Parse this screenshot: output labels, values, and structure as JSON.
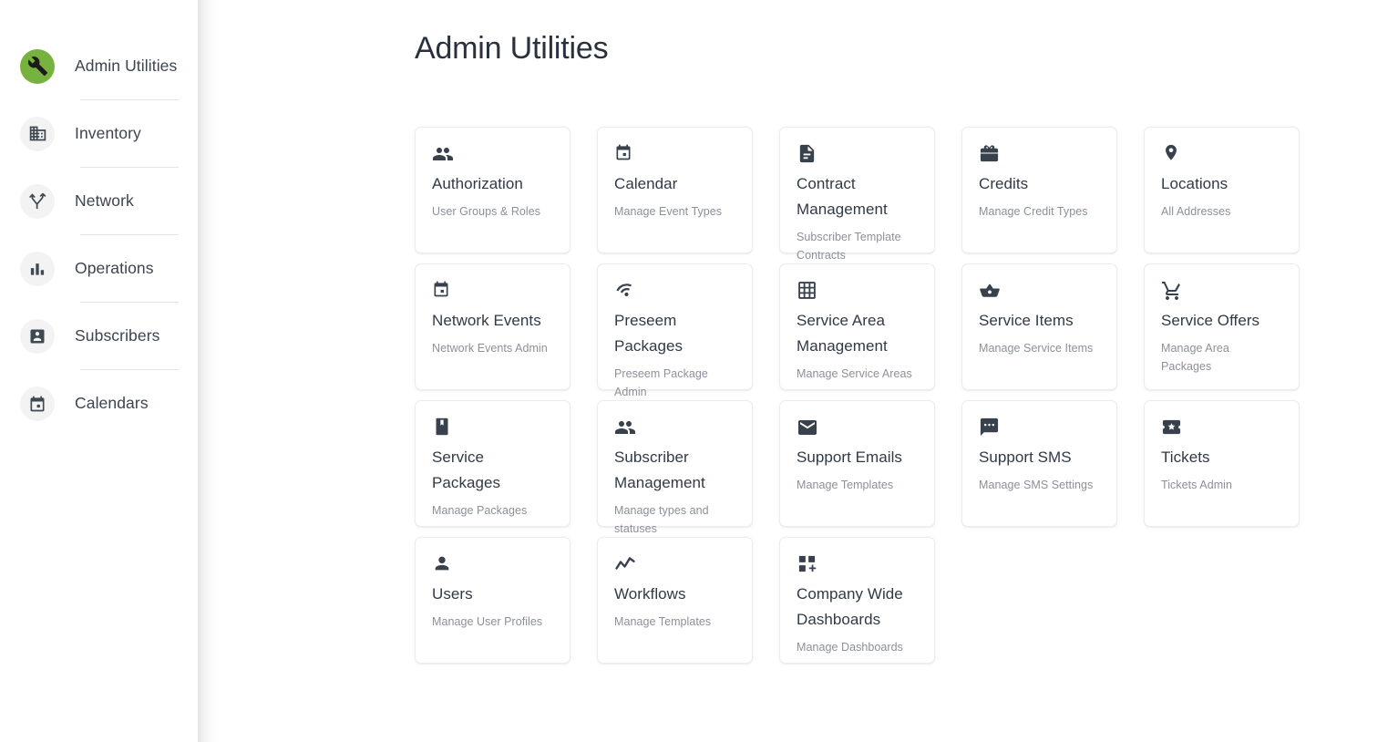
{
  "sidebar": {
    "items": [
      {
        "label": "Admin Utilities",
        "icon": "wrench-icon",
        "active": true
      },
      {
        "label": "Inventory",
        "icon": "building-icon",
        "active": false
      },
      {
        "label": "Network",
        "icon": "network-fork-icon",
        "active": false
      },
      {
        "label": "Operations",
        "icon": "bar-chart-icon",
        "active": false
      },
      {
        "label": "Subscribers",
        "icon": "contact-card-icon",
        "active": false
      },
      {
        "label": "Calendars",
        "icon": "calendar-icon",
        "active": false
      }
    ]
  },
  "main": {
    "title": "Admin Utilities",
    "cards": [
      {
        "title": "Authorization",
        "sub": "User Groups & Roles",
        "icon": "people-icon"
      },
      {
        "title": "Calendar",
        "sub": "Manage Event Types",
        "icon": "calendar-icon"
      },
      {
        "title": "Contract Management",
        "sub": "Subscriber Template Contracts",
        "icon": "document-icon"
      },
      {
        "title": "Credits",
        "sub": "Manage Credit Types",
        "icon": "card-giftcard-icon"
      },
      {
        "title": "Locations",
        "sub": "All Addresses",
        "icon": "map-pin-icon"
      },
      {
        "title": "Network Events",
        "sub": "Network Events Admin",
        "icon": "calendar-icon"
      },
      {
        "title": "Preseem Packages",
        "sub": "Preseem Package Admin",
        "icon": "wifi-tethering-icon"
      },
      {
        "title": "Service Area Management",
        "sub": "Manage Service Areas",
        "icon": "grid-table-icon"
      },
      {
        "title": "Service Items",
        "sub": "Manage Service Items",
        "icon": "shopping-basket-icon"
      },
      {
        "title": "Service Offers",
        "sub": "Manage Area Packages",
        "icon": "shopping-cart-icon"
      },
      {
        "title": "Service Packages",
        "sub": "Manage Packages",
        "icon": "bookmark-book-icon"
      },
      {
        "title": "Subscriber Management",
        "sub": "Manage types and statuses",
        "icon": "people-icon"
      },
      {
        "title": "Support Emails",
        "sub": "Manage Templates",
        "icon": "email-icon"
      },
      {
        "title": "Support SMS",
        "sub": "Manage SMS Settings",
        "icon": "chat-bubble-icon"
      },
      {
        "title": "Tickets",
        "sub": "Tickets Admin",
        "icon": "ticket-star-icon"
      },
      {
        "title": "Users",
        "sub": "Manage User Profiles",
        "icon": "person-icon"
      },
      {
        "title": "Workflows",
        "sub": "Manage Templates",
        "icon": "trending-line-icon"
      },
      {
        "title": "Company Wide Dashboards",
        "sub": "Manage Dashboards",
        "icon": "dashboard-customize-icon"
      }
    ]
  },
  "colors": {
    "accent_green": "#76b23d",
    "text_primary": "#303a46",
    "text_muted": "#8b9099",
    "card_border": "#ececec"
  }
}
